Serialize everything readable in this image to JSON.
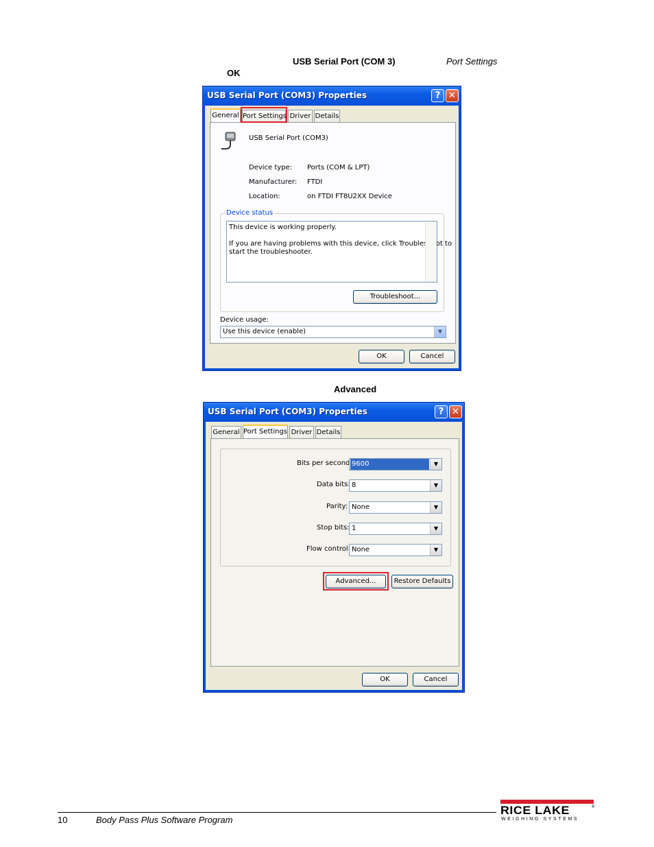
{
  "intro": {
    "usb_port": "USB Serial Port (COM 3)",
    "port_settings": "Port Settings",
    "ok": "OK"
  },
  "dialog1": {
    "title": "USB Serial Port (COM3) Properties",
    "tabs": [
      "General",
      "Port Settings",
      "Driver",
      "Details"
    ],
    "device_name": "USB Serial Port (COM3)",
    "props": [
      {
        "label": "Device type:",
        "value": "Ports (COM & LPT)"
      },
      {
        "label": "Manufacturer:",
        "value": "FTDI"
      },
      {
        "label": "Location:",
        "value": "on FTDI FT8U2XX Device"
      }
    ],
    "status_title": "Device status",
    "status_line1": "This device is working properly.",
    "status_line2": "If you are having problems with this device, click Troubleshoot to",
    "status_line3": "start the troubleshooter.",
    "troubleshoot": "Troubleshoot...",
    "usage_label": "Device usage:",
    "usage_value": "Use this device (enable)",
    "ok": "OK",
    "cancel": "Cancel"
  },
  "caption2": "Advanced",
  "dialog2": {
    "title": "USB Serial Port (COM3) Properties",
    "tabs": [
      "General",
      "Port Settings",
      "Driver",
      "Details"
    ],
    "fields": [
      {
        "label": "Bits per second:",
        "value": "9600"
      },
      {
        "label": "Data bits:",
        "value": "8"
      },
      {
        "label": "Parity:",
        "value": "None"
      },
      {
        "label": "Stop bits:",
        "value": "1"
      },
      {
        "label": "Flow control:",
        "value": "None"
      }
    ],
    "advanced": "Advanced...",
    "restore": "Restore Defaults",
    "ok": "OK",
    "cancel": "Cancel"
  },
  "footer": {
    "page_number": "10",
    "doc_title": "Body Pass Plus Software Program",
    "logo_main": "RICE LAKE",
    "logo_sub": "WEIGHING SYSTEMS",
    "logo_mark": "®"
  },
  "colors": {
    "highlight": "#e0202e",
    "xp_blue": "#0a4fd6",
    "logo_red": "#d71f2b"
  }
}
